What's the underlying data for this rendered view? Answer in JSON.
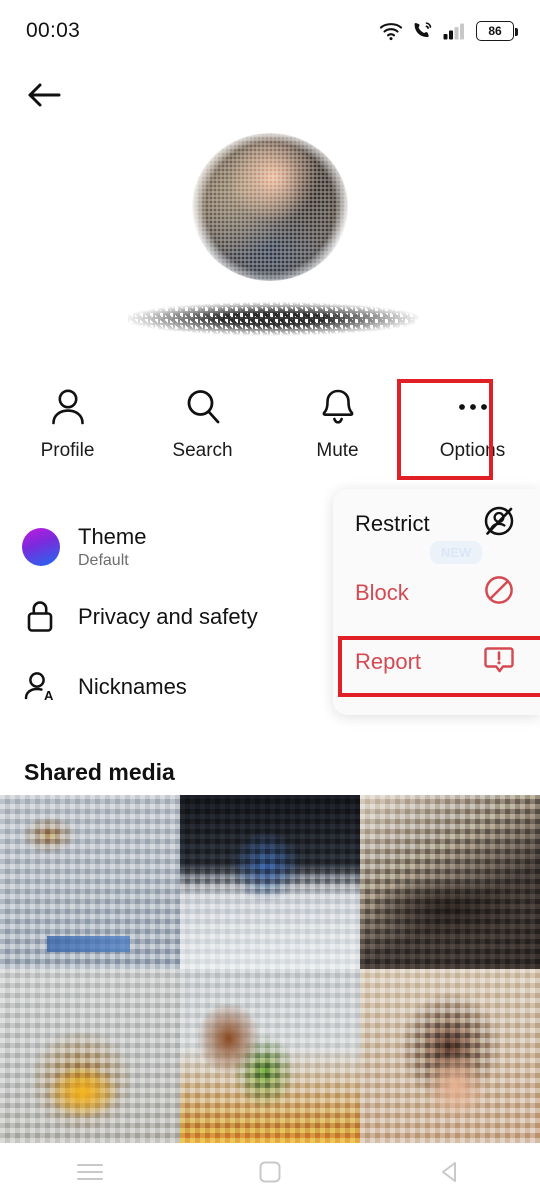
{
  "status_bar": {
    "time": "00:03",
    "battery_level": "86",
    "icons": [
      "wifi-icon",
      "call-signal-icon",
      "cellular-signal-icon",
      "battery-icon"
    ]
  },
  "header": {
    "back_icon": "back-arrow-icon",
    "avatar": "profile-avatar-redacted",
    "contact_name": "[redacted]"
  },
  "quick_actions": [
    {
      "label": "Profile",
      "icon": "person-icon"
    },
    {
      "label": "Search",
      "icon": "search-icon"
    },
    {
      "label": "Mute",
      "icon": "bell-icon"
    },
    {
      "label": "Options",
      "icon": "three-dots-icon"
    }
  ],
  "settings": [
    {
      "label": "Theme",
      "sublabel": "Default",
      "icon": "theme-color-circle-icon"
    },
    {
      "label": "Privacy and safety",
      "sublabel": "",
      "icon": "lock-icon"
    },
    {
      "label": "Nicknames",
      "sublabel": "",
      "icon": "person-letter-a-icon"
    }
  ],
  "options_menu": [
    {
      "label": "Restrict",
      "icon": "restrict-person-icon",
      "badge": "NEW",
      "style": "dark"
    },
    {
      "label": "Block",
      "icon": "block-circle-slash-icon",
      "badge": "",
      "style": "danger"
    },
    {
      "label": "Report",
      "icon": "report-exclamation-bubble-icon",
      "badge": "",
      "style": "danger"
    }
  ],
  "shared_media": {
    "title": "Shared media",
    "thumbnails": [
      "media-thumbnail-1",
      "media-thumbnail-2",
      "media-thumbnail-3",
      "media-thumbnail-4",
      "media-thumbnail-5",
      "media-thumbnail-6"
    ]
  },
  "nav_bar": {
    "recents_icon": "menu-lines-icon",
    "home_icon": "square-icon",
    "back_icon": "triangle-back-icon"
  },
  "highlights": {
    "color": "#e01f26",
    "targets": [
      "Options",
      "Report"
    ]
  }
}
